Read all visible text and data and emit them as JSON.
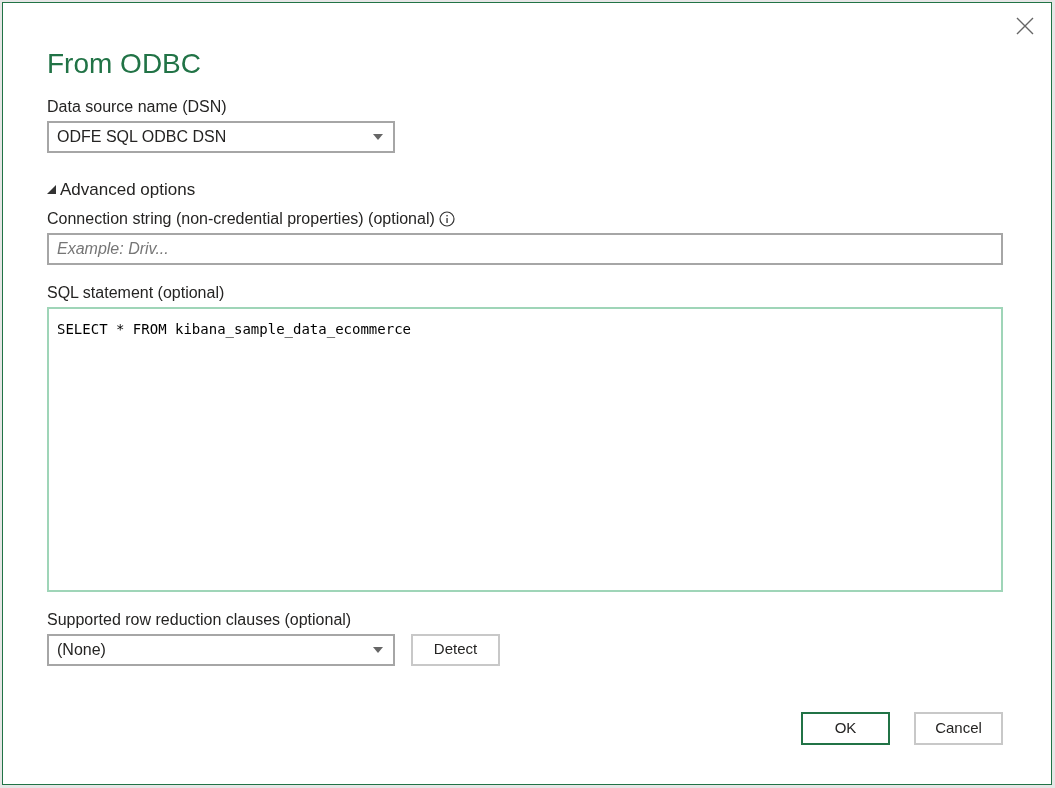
{
  "dialog": {
    "title": "From ODBC"
  },
  "dsn": {
    "label": "Data source name (DSN)",
    "value": "ODFE SQL ODBC DSN"
  },
  "advanced": {
    "label": "Advanced options",
    "expanded": true
  },
  "connection_string": {
    "label": "Connection string (non-credential properties) (optional)",
    "placeholder": "Example: Driv..."
  },
  "sql": {
    "label": "SQL statement (optional)",
    "value": "SELECT * FROM kibana_sample_data_ecommerce",
    "focused": true
  },
  "row_reduction": {
    "label": "Supported row reduction clauses (optional)",
    "value": "(None)",
    "button": "Detect"
  },
  "buttons": [
    {
      "label": "OK",
      "default": true
    },
    {
      "label": "Cancel",
      "default": false
    }
  ]
}
